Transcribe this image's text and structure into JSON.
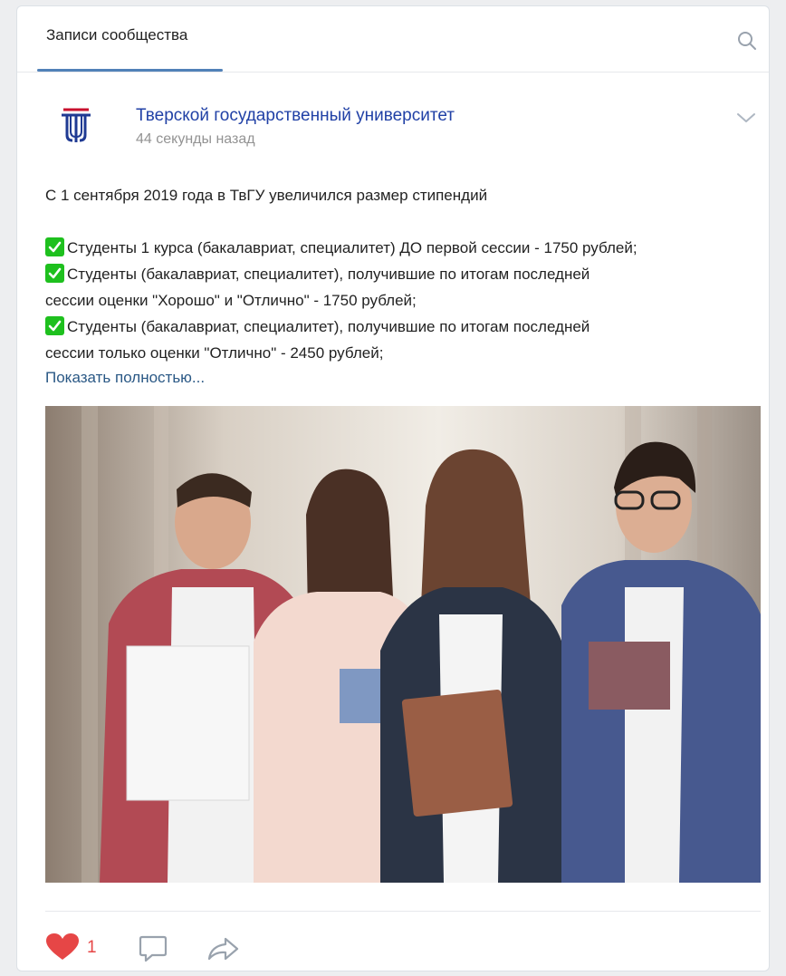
{
  "tabs": {
    "active_label": "Записи сообщества"
  },
  "icons": {
    "search": "search-icon",
    "chevron": "chevron-down-icon",
    "like": "heart-icon",
    "comment": "comment-icon",
    "share": "share-icon",
    "check": "check-mark-icon"
  },
  "post": {
    "author": "Тверской государственный университет",
    "time": "44 секунды назад",
    "lines": [
      "С 1 сентября 2019 года в ТвГУ увеличился размер стипендий",
      "Студенты 1 курса (бакалавриат, специалитет) ДО первой сессии - 1750 рублей;",
      "Студенты (бакалавриат, специалитет), получившие по итогам последней",
      "сессии оценки \"Хорошо\" и \"Отлично\" - 1750 рублей;",
      "Студенты (бакалавриат, специалитет), получившие по итогам последней",
      "сессии только оценки \"Отлично\" - 2450 рублей;"
    ],
    "show_more": "Показать полностью...",
    "photo": "students-holding-books-photo",
    "likes": "1"
  },
  "colors": {
    "link": "#2a5885",
    "author": "#2141a6",
    "like": "#e64646",
    "check": "#1ec01e",
    "tab_accent": "#5181b8"
  }
}
